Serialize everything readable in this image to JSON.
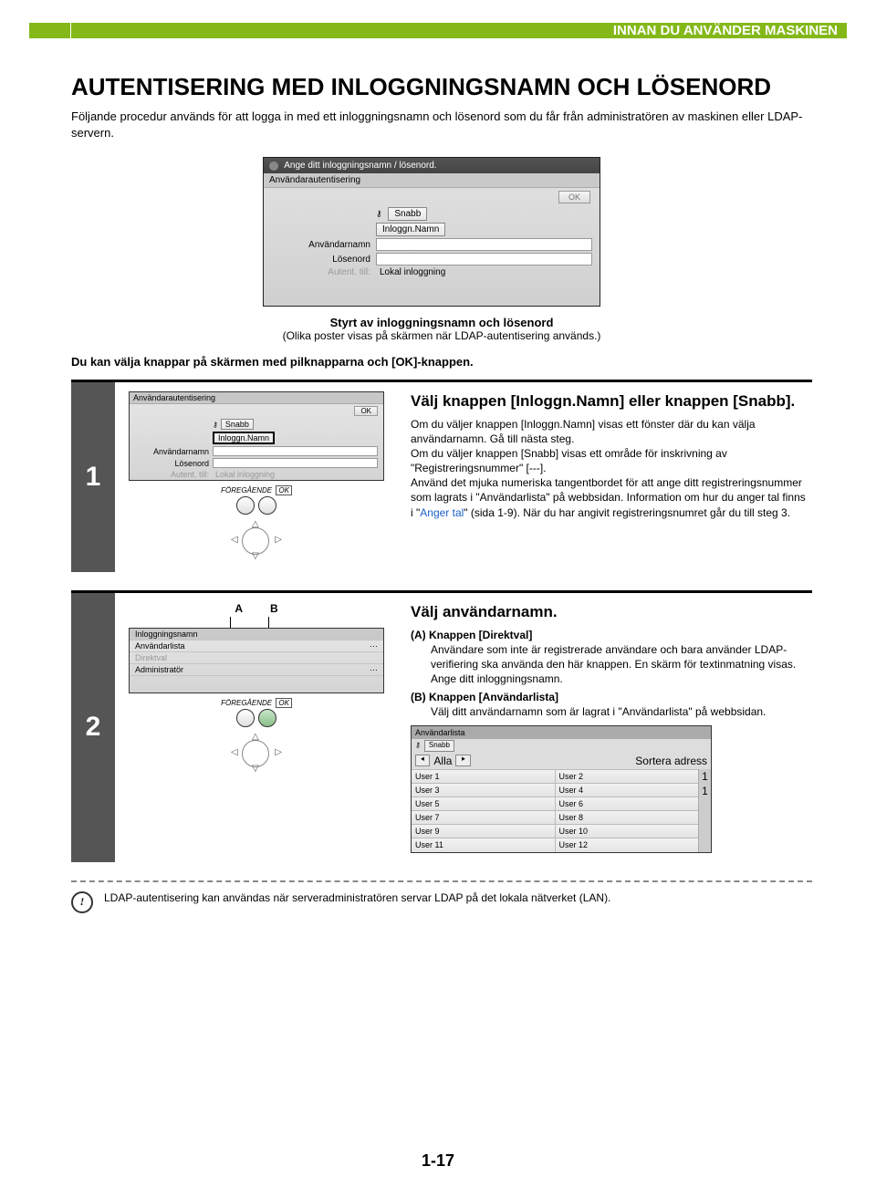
{
  "header": {
    "section_title": "INNAN DU ANVÄNDER MASKINEN"
  },
  "title": "AUTENTISERING MED INLOGGNINGSNAMN OCH LÖSENORD",
  "intro": "Följande procedur används för att logga in med ett inloggningsnamn och lösenord som du får från administratören av maskinen eller LDAP-servern.",
  "panel_main": {
    "hdr": "Ange ditt inloggningsnamn / lösenord.",
    "sub": "Användarautentisering",
    "ok": "OK",
    "snabb": "Snabb",
    "inloggn": "Inloggn.Namn",
    "anv": "Användarnamn",
    "losen": "Lösenord",
    "autent": "Autent. till:",
    "lokal": "Lokal inloggning"
  },
  "caption1": "Styrt av inloggningsnamn och lösenord",
  "caption2": "(Olika poster visas på skärmen när LDAP-autentisering används.)",
  "pre_note": "Du kan välja knappar på skärmen med pilknapparna och [OK]-knappen.",
  "step1": {
    "num": "1",
    "heading": "Välj knappen [Inloggn.Namn] eller knappen [Snabb].",
    "p1": "Om du väljer knappen [Inloggn.Namn] visas ett fönster där du kan välja användarnamn. Gå till nästa steg.",
    "p2a": "Om du väljer knappen [Snabb] visas ett område för inskrivning av \"Registreringsnummer\" [---].",
    "p2b": "Använd det mjuka numeriska tangentbordet för att ange ditt registreringsnummer som lagrats i \"Användarlista\" på webbsidan. Information om hur du anger tal finns i \"",
    "link": "Anger tal",
    "p2c": "\" (sida 1-9). När du har angivit registreringsnumret går du till steg 3.",
    "ctrl_prev": "FÖREGÅENDE",
    "ctrl_ok": "OK",
    "mini": {
      "hdr": "Användarautentisering",
      "ok": "OK",
      "snabb": "Snabb",
      "inloggn": "Inloggn.Namn",
      "anv": "Användarnamn",
      "losen": "Lösenord",
      "autent": "Autent. till:",
      "lokal": "Lokal inloggning"
    }
  },
  "step2": {
    "num": "2",
    "heading": "Välj användarnamn.",
    "a_label": "(A) Knappen [Direktval]",
    "a_text": "Användare som inte är registrerade användare och bara använder LDAP-verifiering ska använda den här knappen. En skärm för textinmatning visas. Ange ditt inloggningsnamn.",
    "b_label": "(B) Knappen [Användarlista]",
    "b_text": "Välj ditt användarnamn som är lagrat i \"Användarlista\" på webbsidan.",
    "A": "A",
    "B": "B",
    "ctrl_prev": "FÖREGÅENDE",
    "ctrl_ok": "OK",
    "mini": {
      "r1": "Inloggningsnamn",
      "r2": "Användarlista",
      "r3": "Direktval",
      "r4": "Administratör"
    },
    "userlist": {
      "hdr": "Användarlista",
      "snabb": "Snabb",
      "all": "Alla",
      "sort": "Sortera adress",
      "rows": [
        [
          "User 1",
          "User 2"
        ],
        [
          "User 3",
          "User 4"
        ],
        [
          "User 5",
          "User 6"
        ],
        [
          "User 7",
          "User 8"
        ],
        [
          "User 9",
          "User 10"
        ],
        [
          "User 11",
          "User 12"
        ]
      ],
      "scroll": "1"
    }
  },
  "tip": "LDAP-autentisering kan användas när serveradministratören servar LDAP på det lokala nätverket (LAN).",
  "page_number": "1-17"
}
